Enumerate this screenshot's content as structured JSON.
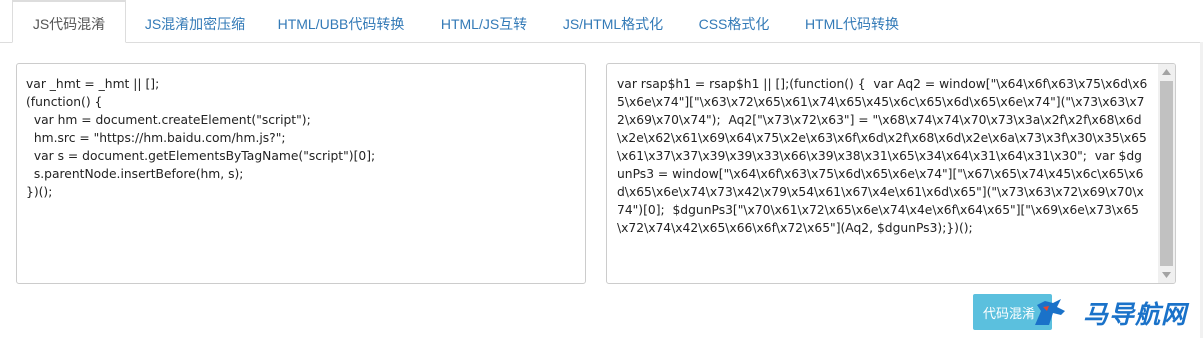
{
  "tabs": [
    {
      "label": "JS代码混淆",
      "active": true
    },
    {
      "label": "JS混淆加密压缩",
      "active": false
    },
    {
      "label": "HTML/UBB代码转换",
      "active": false
    },
    {
      "label": "HTML/JS互转",
      "active": false
    },
    {
      "label": "JS/HTML格式化",
      "active": false
    },
    {
      "label": "CSS格式化",
      "active": false
    },
    {
      "label": "HTML代码转换",
      "active": false
    }
  ],
  "input": {
    "code": "var _hmt = _hmt || [];\n(function() {\n  var hm = document.createElement(\"script\");\n  hm.src = \"https://hm.baidu.com/hm.js?\";\n  var s = document.getElementsByTagName(\"script\")[0];\n  s.parentNode.insertBefore(hm, s);\n})();"
  },
  "output": {
    "code": "var rsap$h1 = rsap$h1 || [];(function() {  var Aq2 = window[\"\\x64\\x6f\\x63\\x75\\x6d\\x65\\x6e\\x74\"][\"\\x63\\x72\\x65\\x61\\x74\\x65\\x45\\x6c\\x65\\x6d\\x65\\x6e\\x74\"](\"\\x73\\x63\\x72\\x69\\x70\\x74\");  Aq2[\"\\x73\\x72\\x63\"] = \"\\x68\\x74\\x74\\x70\\x73\\x3a\\x2f\\x2f\\x68\\x6d\\x2e\\x62\\x61\\x69\\x64\\x75\\x2e\\x63\\x6f\\x6d\\x2f\\x68\\x6d\\x2e\\x6a\\x73\\x3f\\x30\\x35\\x65\\x61\\x37\\x37\\x39\\x39\\x33\\x66\\x39\\x38\\x31\\x65\\x34\\x64\\x31\\x64\\x31\\x30\";  var $dgunPs3 = window[\"\\x64\\x6f\\x63\\x75\\x6d\\x65\\x6e\\x74\"][\"\\x67\\x65\\x74\\x45\\x6c\\x65\\x6d\\x65\\x6e\\x74\\x73\\x42\\x79\\x54\\x61\\x67\\x4e\\x61\\x6d\\x65\"](\"\\x73\\x63\\x72\\x69\\x70\\x74\")[0];  $dgunPs3[\"\\x70\\x61\\x72\\x65\\x6e\\x74\\x4e\\x6f\\x64\\x65\"][\"\\x69\\x6e\\x73\\x65\\x72\\x74\\x42\\x65\\x66\\x6f\\x72\\x65\"](Aq2, $dgunPs3);})();"
  },
  "button": {
    "label": "代码混淆"
  },
  "watermark": {
    "text": "马导航网"
  },
  "colors": {
    "link": "#337ab7",
    "button": "#5bc0de",
    "watermark": "#1a72c9"
  }
}
